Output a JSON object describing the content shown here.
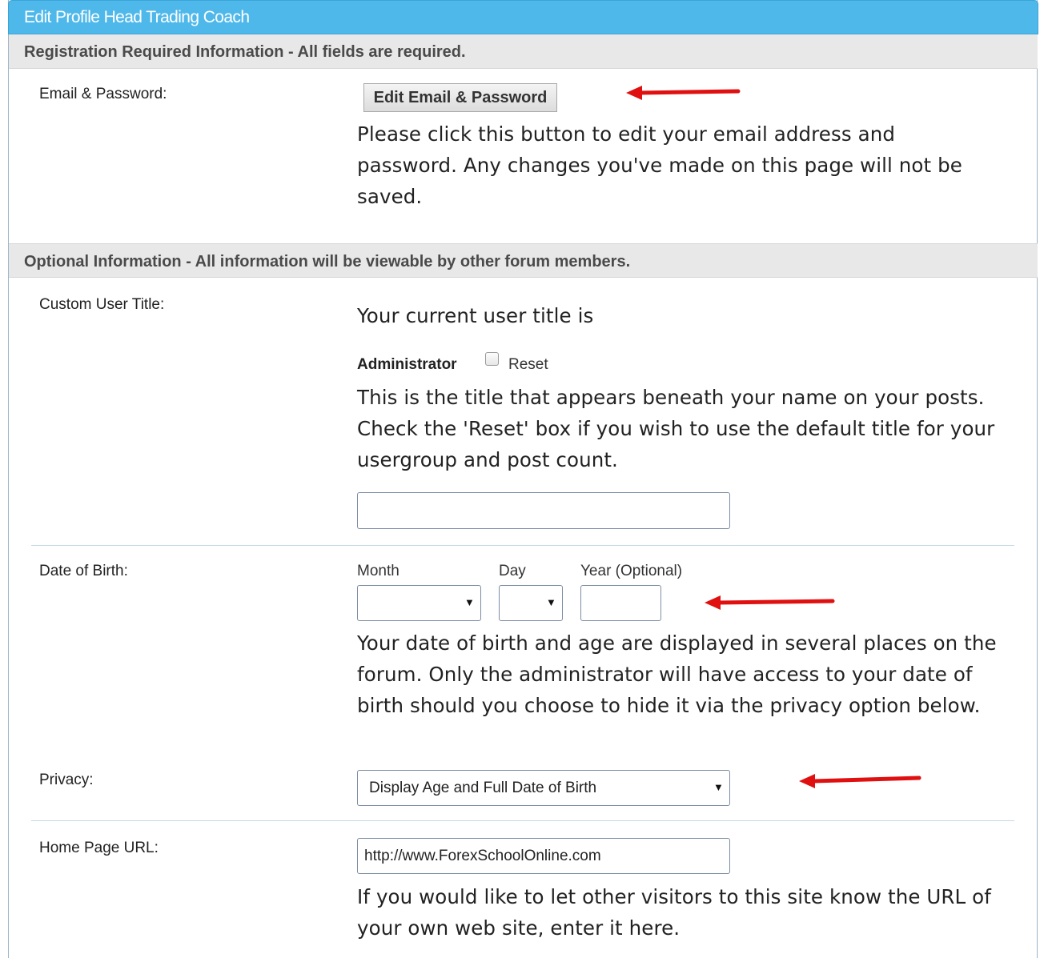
{
  "window": {
    "title": "Edit Profile Head Trading Coach"
  },
  "sections": {
    "required": {
      "heading": "Registration Required Information - All fields are required."
    },
    "optional": {
      "heading": "Optional Information - All information will be viewable by other forum members."
    }
  },
  "email_password": {
    "label": "Email & Password:",
    "button_label": "Edit Email & Password",
    "description": "Please click this button to edit your email address and password. Any changes you've made on this page will not be saved."
  },
  "custom_user_title": {
    "label": "Custom User Title:",
    "intro": "Your current user title is",
    "current_title": "Administrator",
    "reset_label": "Reset",
    "reset_checked": false,
    "description": "This is the title that appears beneath your name on your posts. Check the 'Reset' box if you wish to use the default title for your usergroup and post count.",
    "input_value": ""
  },
  "date_of_birth": {
    "label": "Date of Birth:",
    "month_label": "Month",
    "day_label": "Day",
    "year_label": "Year (Optional)",
    "month_value": "",
    "day_value": "",
    "year_value": "",
    "description": "Your date of birth and age are displayed in several places on the forum. Only the administrator will have access to your date of birth should you choose to hide it via the privacy option below."
  },
  "privacy": {
    "label": "Privacy:",
    "selected": "Display Age and Full Date of Birth"
  },
  "home_page": {
    "label": "Home Page URL:",
    "value": "http://www.ForexSchoolOnline.com",
    "description": "If you would like to let other visitors to this site know the URL of your own web site, enter it here."
  },
  "colors": {
    "titlebar": "#4fb8ea",
    "section_bg": "#e8e8e8",
    "annotation_arrow": "#e01010"
  },
  "icons": {
    "dropdown": "triangle-down",
    "annotation": "red-arrow-left"
  }
}
